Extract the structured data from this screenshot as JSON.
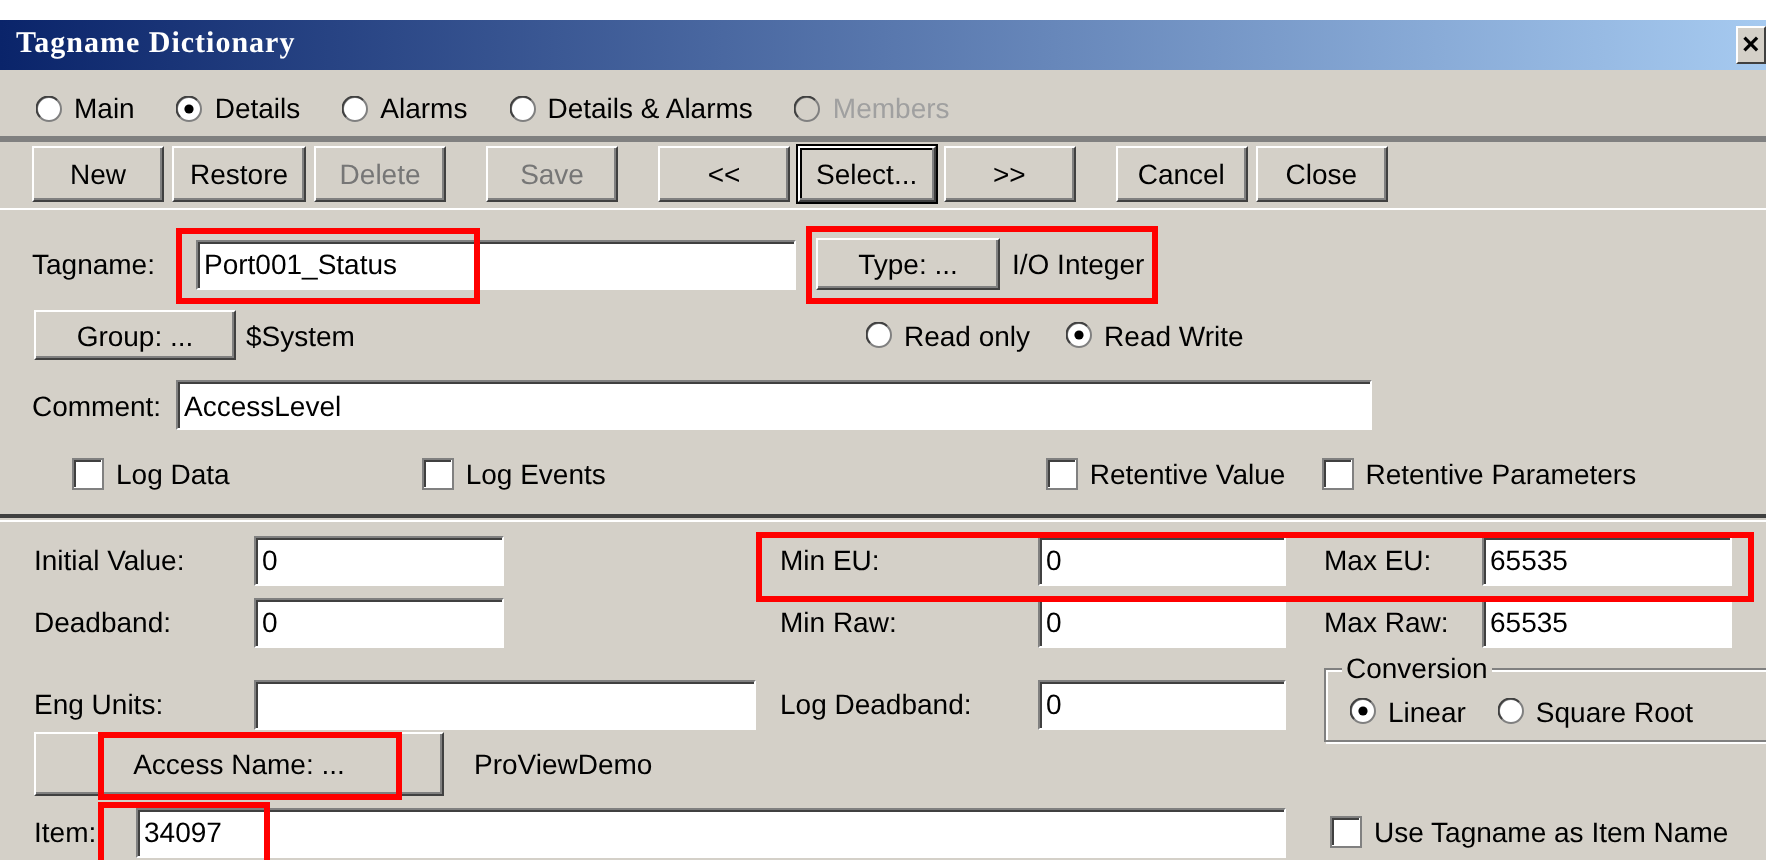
{
  "window": {
    "title": "Tagname Dictionary",
    "close": "×"
  },
  "views": [
    {
      "label": "Main",
      "selected": false,
      "disabled": false
    },
    {
      "label": "Details",
      "selected": true,
      "disabled": false
    },
    {
      "label": "Alarms",
      "selected": false,
      "disabled": false
    },
    {
      "label": "Details & Alarms",
      "selected": false,
      "disabled": false
    },
    {
      "label": "Members",
      "selected": false,
      "disabled": true
    }
  ],
  "toolbar": [
    [
      {
        "label": "New",
        "disabled": false,
        "default": false
      },
      {
        "label": "Restore",
        "disabled": false,
        "default": false
      },
      {
        "label": "Delete",
        "disabled": true,
        "default": false
      }
    ],
    [
      {
        "label": "Save",
        "disabled": true,
        "default": false
      }
    ],
    [
      {
        "label": "<<",
        "disabled": false,
        "default": false
      },
      {
        "label": "Select...",
        "disabled": false,
        "default": true
      },
      {
        "label": ">>",
        "disabled": false,
        "default": false
      }
    ],
    [
      {
        "label": "Cancel",
        "disabled": false,
        "default": false
      },
      {
        "label": "Close",
        "disabled": false,
        "default": false
      }
    ]
  ],
  "tagname": {
    "label": "Tagname:",
    "value": "Port001_Status",
    "highlighted": true
  },
  "type": {
    "button": "Type: ...",
    "value": "I/O Integer",
    "highlighted": true
  },
  "group": {
    "button": "Group: ...",
    "value": "$System"
  },
  "access_modes": [
    {
      "label": "Read only",
      "selected": false
    },
    {
      "label": "Read Write",
      "selected": true
    }
  ],
  "comment": {
    "label": "Comment:",
    "value": "AccessLevel"
  },
  "options": [
    {
      "label": "Log Data",
      "checked": false
    },
    {
      "label": "Log Events",
      "checked": false
    },
    {
      "label": "Retentive Value",
      "checked": false
    },
    {
      "label": "Retentive Parameters",
      "checked": false
    }
  ],
  "initial_value": {
    "label": "Initial Value:",
    "value": "0"
  },
  "limits": {
    "highlighted": true,
    "min_eu": {
      "label": "Min EU:",
      "value": "0"
    },
    "max_eu": {
      "label": "Max EU:",
      "value": "65535"
    }
  },
  "deadband": {
    "label": "Deadband:",
    "value": "0"
  },
  "min_raw": {
    "label": "Min Raw:",
    "value": "0"
  },
  "max_raw": {
    "label": "Max Raw:",
    "value": "65535"
  },
  "eng_units": {
    "label": "Eng Units:"
  },
  "log_deadband": {
    "label": "Log Deadband:",
    "value": "0"
  },
  "conversion": {
    "title": "Conversion",
    "options": [
      {
        "label": "Linear",
        "selected": true
      },
      {
        "label": "Square Root",
        "selected": false
      }
    ]
  },
  "access_name": {
    "button": "Access Name: ...",
    "value": "ProViewDemo",
    "highlighted": true
  },
  "item": {
    "label": "Item:",
    "value": "34097",
    "highlighted": true
  },
  "use_tagname": {
    "label": "Use Tagname as Item Name",
    "checked": false
  }
}
